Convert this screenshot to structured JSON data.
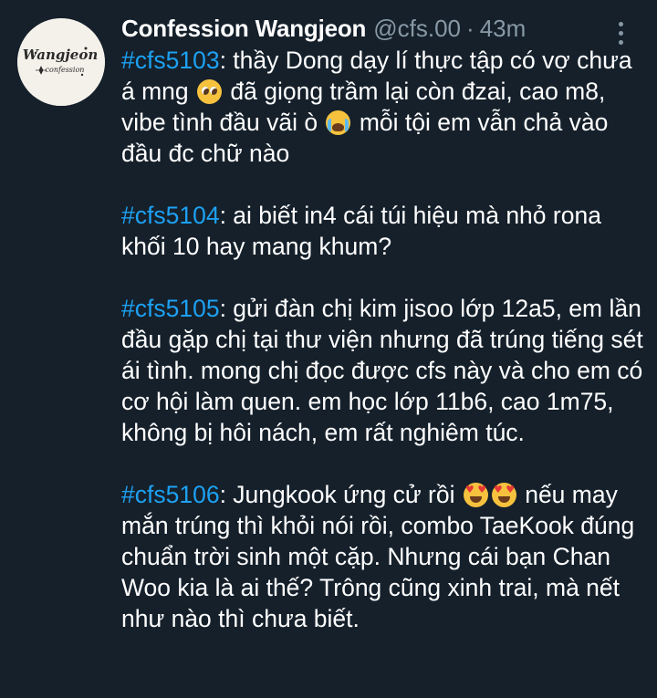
{
  "account": {
    "display_name": "Confession Wangjeon",
    "handle": "@cfs.00",
    "separator": "·",
    "time": "43m",
    "avatar_text_top": "Wangjeon",
    "avatar_text_bottom": "confession",
    "avatar_icon": "wangjeon-logo"
  },
  "menu": {
    "icon": "more-vertical-icon"
  },
  "confessions": [
    {
      "hashtag": "#cfs5103",
      "parts": [
        ": thầy Dong dạy lí thực tập có vợ chưa á mng ",
        " đã giọng trầm lại còn đzai, cao m8, vibe tình đầu vãi ò ",
        " mỗi tội em vẫn chả vào đầu đc chữ nào"
      ],
      "emojis": [
        "pleading-face",
        "loudly-crying-face"
      ]
    },
    {
      "hashtag": "#cfs5104",
      "text": ": ai biết in4 cái túi hiệu mà nhỏ rona khối 10 hay mang khum?"
    },
    {
      "hashtag": "#cfs5105",
      "text": ": gửi đàn chị kim jisoo lớp 12a5, em lần đầu gặp chị tại thư viện nhưng đã trúng tiếng sét ái tình. mong chị đọc được cfs này và cho em có cơ hội làm quen. em học lớp 11b6, cao 1m75, không bị hôi nách, em rất nghiêm túc."
    },
    {
      "hashtag": "#cfs5106",
      "parts": [
        ": Jungkook ứng cử rồi ",
        " nếu may mắn trúng thì khỏi nói rồi, combo TaeKook đúng chuẩn trời sinh một cặp. Nhưng cái bạn Chan Woo kia là ai thế? Trông cũng xinh trai, mà nết như nào thì chưa biết."
      ],
      "emojis": [
        "smiling-face-with-heart-eyes",
        "smiling-face-with-heart-eyes"
      ]
    }
  ],
  "colors": {
    "background": "#15202b",
    "text": "#ffffff",
    "secondary_text": "#8899a6",
    "hashtag": "#1da1f2"
  }
}
